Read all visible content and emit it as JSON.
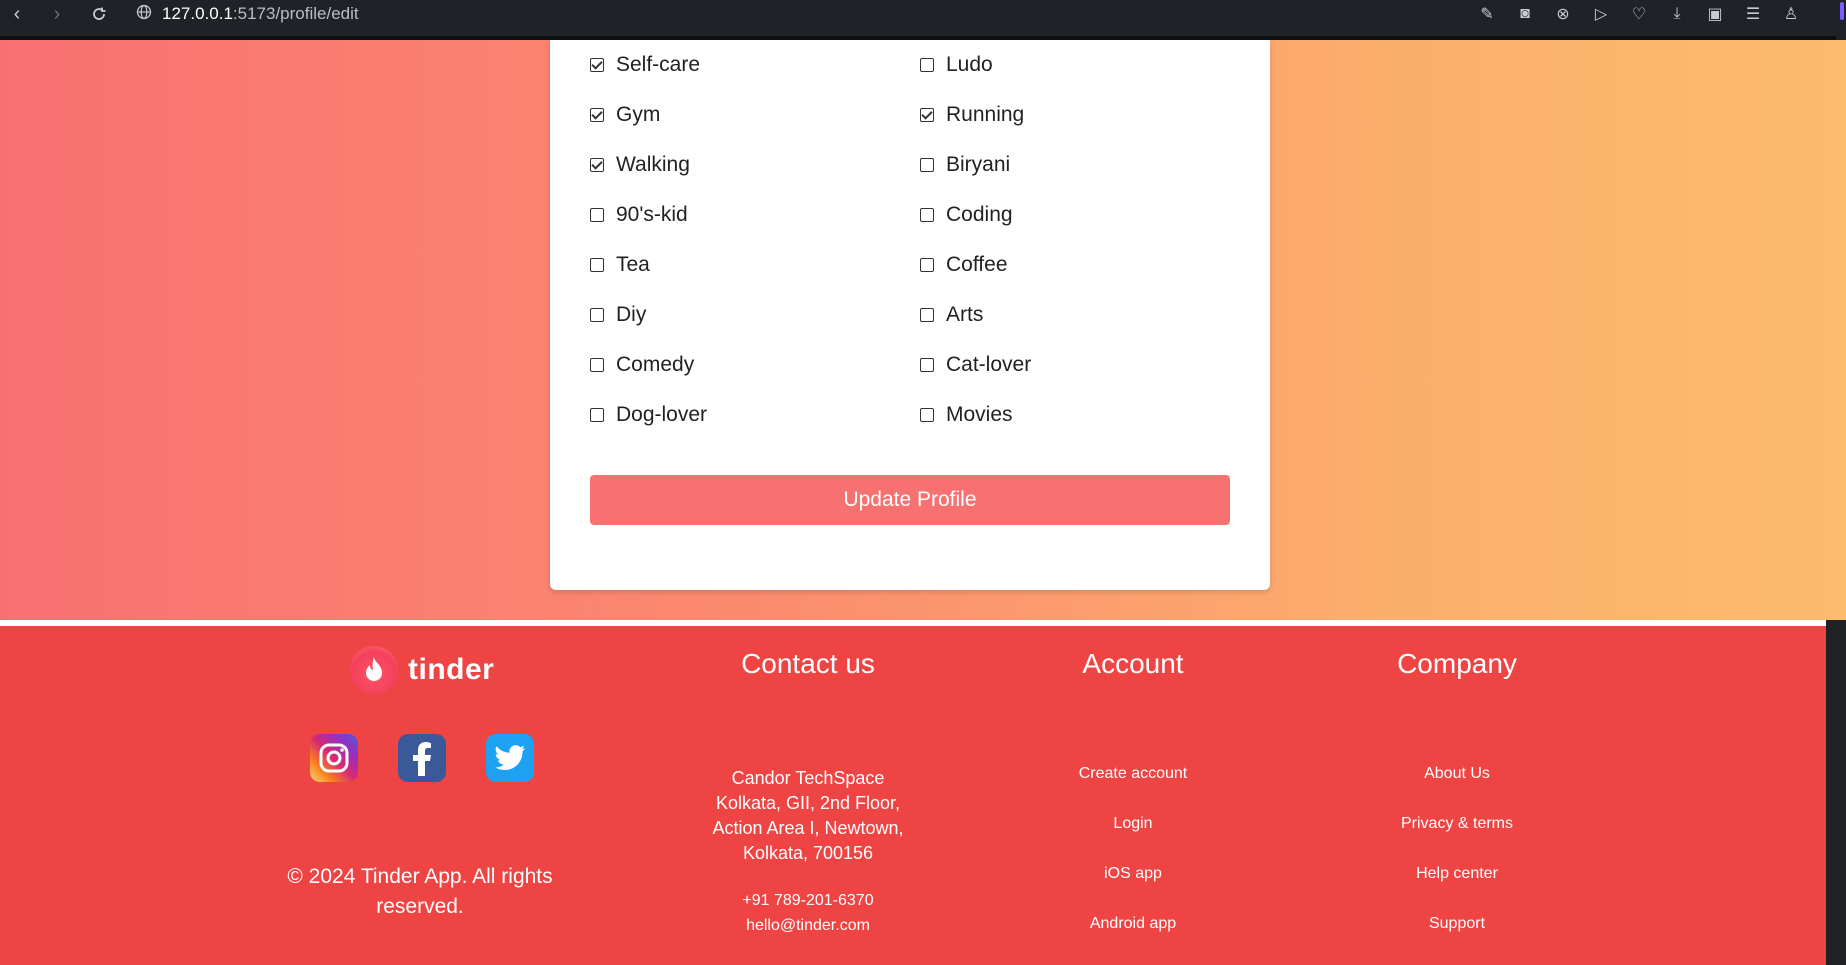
{
  "browser": {
    "url_host": "127.0.0.1",
    "url_path": ":5173/profile/edit"
  },
  "interests": {
    "left": [
      {
        "label": "Self-care",
        "checked": true
      },
      {
        "label": "Gym",
        "checked": true
      },
      {
        "label": "Walking",
        "checked": true
      },
      {
        "label": "90's-kid",
        "checked": false
      },
      {
        "label": "Tea",
        "checked": false
      },
      {
        "label": "Diy",
        "checked": false
      },
      {
        "label": "Comedy",
        "checked": false
      },
      {
        "label": "Dog-lover",
        "checked": false
      }
    ],
    "right": [
      {
        "label": "Ludo",
        "checked": false
      },
      {
        "label": "Running",
        "checked": true
      },
      {
        "label": "Biryani",
        "checked": false
      },
      {
        "label": "Coding",
        "checked": false
      },
      {
        "label": "Coffee",
        "checked": false
      },
      {
        "label": "Arts",
        "checked": false
      },
      {
        "label": "Cat-lover",
        "checked": false
      },
      {
        "label": "Movies",
        "checked": false
      }
    ]
  },
  "update_button": "Update Profile",
  "footer": {
    "brand": "tinder",
    "copyright": "© 2024 Tinder App. All rights reserved.",
    "contact": {
      "title": "Contact us",
      "address_lines": [
        "Candor TechSpace",
        "Kolkata, GII, 2nd Floor,",
        "Action Area I, Newtown,",
        "Kolkata, 700156"
      ],
      "phone": "+91 789-201-6370",
      "email": "hello@tinder.com"
    },
    "account": {
      "title": "Account",
      "links": [
        "Create account",
        "Login",
        "iOS app",
        "Android app"
      ]
    },
    "company": {
      "title": "Company",
      "links": [
        "About Us",
        "Privacy & terms",
        "Help center",
        "Support"
      ]
    }
  },
  "colors": {
    "footer_bg": "#ef4444",
    "button_bg": "#f87171",
    "gradient_start": "#f87171",
    "gradient_end": "#fdbb6e"
  }
}
